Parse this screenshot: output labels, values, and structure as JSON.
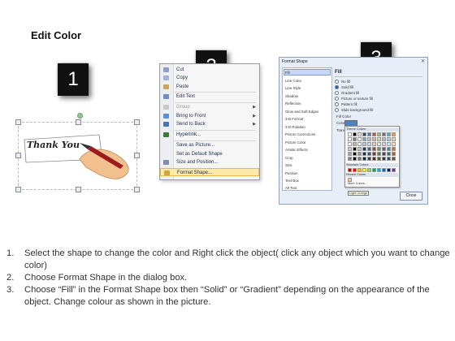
{
  "title": "Edit Color",
  "steps_badges": [
    "1",
    "2",
    "3"
  ],
  "panel1": {
    "shape_text": "Thank You"
  },
  "context_menu": {
    "items": [
      {
        "label": "Cut",
        "icon": "scissors-icon"
      },
      {
        "label": "Copy",
        "icon": "copy-icon"
      },
      {
        "label": "Paste",
        "icon": "paste-icon"
      },
      {
        "label": "Edit Text",
        "icon": "edit-text-icon"
      },
      {
        "label": "Group",
        "icon": "group-icon"
      },
      {
        "label": "Bring to Front",
        "icon": "bring-front-icon"
      },
      {
        "label": "Send to Back",
        "icon": "send-back-icon"
      },
      {
        "label": "Hyperlink...",
        "icon": "hyperlink-icon"
      },
      {
        "label": "Save as Picture...",
        "icon": "save-picture-icon"
      },
      {
        "label": "Set as Default Shape",
        "icon": "default-shape-icon"
      },
      {
        "label": "Size and Position...",
        "icon": "size-position-icon"
      },
      {
        "label": "Format Shape...",
        "icon": "format-shape-icon"
      }
    ]
  },
  "dialog": {
    "title": "Format Shape",
    "close_x": "✕",
    "categories": [
      "Fill",
      "Line Color",
      "Line Style",
      "Shadow",
      "Reflection",
      "Glow and Soft Edges",
      "3-D Format",
      "3-D Rotation",
      "Picture Corrections",
      "Picture Color",
      "Artistic Effects",
      "Crop",
      "Size",
      "Position",
      "Text Box",
      "Alt Text"
    ],
    "section_title": "Fill",
    "options": [
      "No fill",
      "Solid fill",
      "Gradient fill",
      "Picture or texture fill",
      "Pattern fill",
      "Slide background fill"
    ],
    "fill_color_label": "Fill Color",
    "color_label": "Color:",
    "transparency_label": "Transparency:",
    "palette": {
      "theme_colors": "Theme Colors",
      "standard_colors": "Standard Colors",
      "recent_colors": "Recent Colors",
      "more_colors": "More Colors...",
      "tooltip": "Light Orange"
    },
    "close_button": "Close"
  },
  "instructions": [
    {
      "num": "1.",
      "text": "Select the shape to change the color and Right click the object( click any object which you want to change color)"
    },
    {
      "num": "2.",
      "text": "Choose Format Shape in the dialog box."
    },
    {
      "num": "3.",
      "text": "Choose “Fill” in the Format Shape box then “Solid” or “Gradient” depending on the appearance of the object. Change colour as shown in the picture."
    }
  ]
}
